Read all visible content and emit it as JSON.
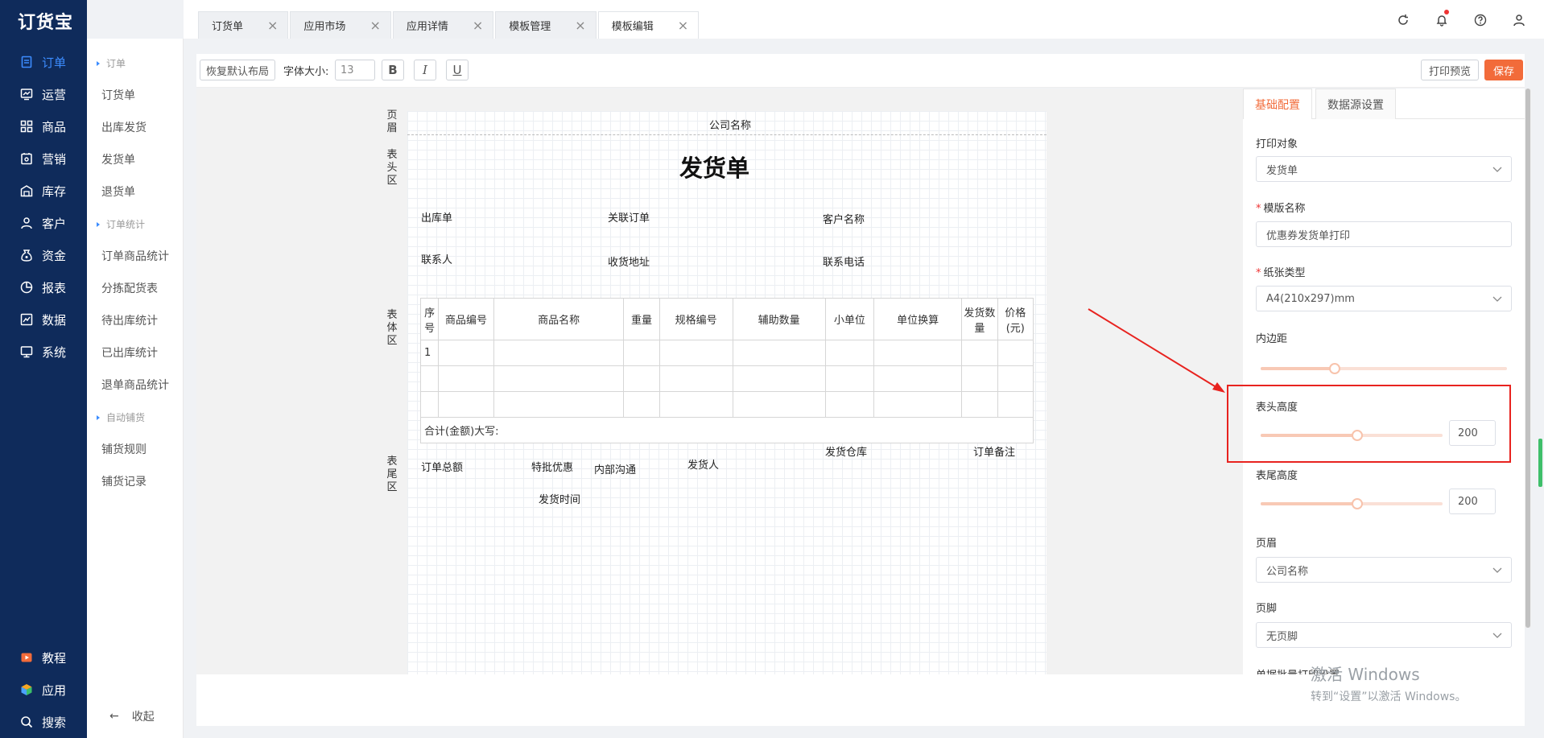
{
  "app": {
    "logo": "订货宝"
  },
  "nav": {
    "items": [
      {
        "label": "订单",
        "icon": "order-icon",
        "active": true
      },
      {
        "label": "运营",
        "icon": "operation-icon"
      },
      {
        "label": "商品",
        "icon": "goods-icon"
      },
      {
        "label": "营销",
        "icon": "marketing-icon"
      },
      {
        "label": "库存",
        "icon": "warehouse-icon"
      },
      {
        "label": "客户",
        "icon": "customer-icon"
      },
      {
        "label": "资金",
        "icon": "funds-icon"
      },
      {
        "label": "报表",
        "icon": "report-icon"
      },
      {
        "label": "数据",
        "icon": "data-icon"
      },
      {
        "label": "系统",
        "icon": "system-icon"
      }
    ],
    "bottom": [
      {
        "label": "教程",
        "icon": "tutorial-icon"
      },
      {
        "label": "应用",
        "icon": "apps-icon"
      },
      {
        "label": "搜索",
        "icon": "search-icon"
      }
    ]
  },
  "subnav": {
    "groups": [
      "订单",
      "订单统计",
      "自动铺货"
    ],
    "items": [
      "订货单",
      "出库发货",
      "发货单",
      "退货单",
      "订单商品统计",
      "分拣配货表",
      "待出库统计",
      "已出库统计",
      "退单商品统计",
      "铺货规则",
      "铺货记录"
    ],
    "collapse": "收起"
  },
  "tabs": [
    "订货单",
    "应用市场",
    "应用详情",
    "模板管理",
    "模板编辑"
  ],
  "toolbar": {
    "reset": "恢复默认布局",
    "font_size_label": "字体大小:",
    "font_size": "13",
    "bold": "B",
    "italic": "I",
    "underline": "U",
    "preview": "打印预览",
    "save": "保存"
  },
  "template": {
    "zones": {
      "header": "页眉",
      "top": "表头区",
      "body": "表体区",
      "bottom": "表尾区"
    },
    "company": "公司名称",
    "title": "发货单",
    "head_fields": [
      "出库单",
      "关联订单",
      "客户名称",
      "联系人",
      "收货地址",
      "联系电话"
    ],
    "columns": [
      "序号",
      "商品编号",
      "商品名称",
      "重量",
      "规格编号",
      "辅助数量",
      "小单位",
      "单位换算",
      "发货数量",
      "价格(元)"
    ],
    "row_1": "1",
    "total": "合计(金额)大写:",
    "foot_fields": [
      "订单总额",
      "特批优惠",
      "内部沟通",
      "发货人",
      "发货仓库",
      "订单备注",
      "发货时间"
    ]
  },
  "panel": {
    "tabs": [
      "基础配置",
      "数据源设置"
    ],
    "print_target_label": "打印对象",
    "print_target": "发货单",
    "template_name_label": "模版名称",
    "template_name": "优惠券发货单打印",
    "paper_type_label": "纸张类型",
    "paper_type": "A4(210x297)mm",
    "padding_label": "内边距",
    "padding_level": 0.3,
    "header_height_label": "表头高度",
    "header_height": "200",
    "footer_height_label": "表尾高度",
    "footer_height": "200",
    "page_header_label": "页眉",
    "page_header": "公司名称",
    "page_footer_label": "页脚",
    "page_footer": "无页脚",
    "batch_label": "单据批量打印设置"
  },
  "watermark": {
    "line1": "激活 Windows",
    "line2": "转到“设置”以激活 Windows。"
  },
  "colors": {
    "nav_bg": "#0f2b5b",
    "accent": "#3c8cff",
    "save": "#f26b3a",
    "highlight": "#e8231f"
  }
}
